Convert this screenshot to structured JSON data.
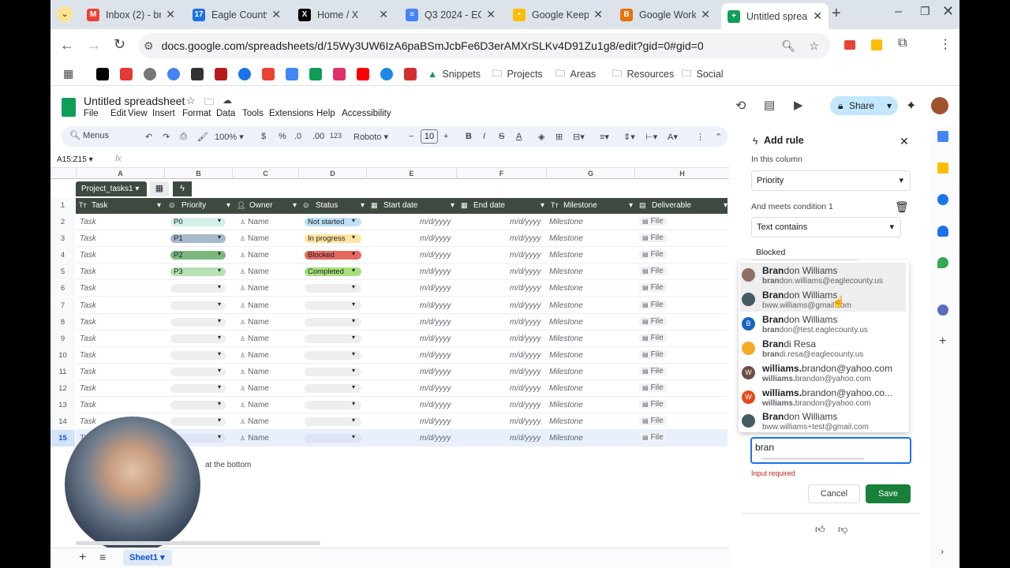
{
  "browser": {
    "tabs": [
      {
        "title": "Inbox (2) - bra",
        "color": "#ea4335",
        "glyph": "M"
      },
      {
        "title": "Eagle County",
        "color": "#1a73e8",
        "glyph": "17"
      },
      {
        "title": "Home / X",
        "color": "#000000",
        "glyph": "X"
      },
      {
        "title": "Q3 2024 - EC",
        "color": "#4285f4",
        "glyph": "≡"
      },
      {
        "title": "Google Keep",
        "color": "#fbbc04",
        "glyph": "•"
      },
      {
        "title": "Google Work",
        "color": "#e8710a",
        "glyph": "B"
      },
      {
        "title": "Untitled sprea",
        "color": "#0f9d58",
        "glyph": "+"
      }
    ],
    "url": "docs.google.com/spreadsheets/d/15Wy3UW6IzA6paBSmJcbFe6D3erAMXrSLKv4D91Zu1g8/edit?gid=0#gid=0",
    "bookmarks": [
      "Snippets",
      "Projects",
      "Areas",
      "Resources",
      "Social"
    ]
  },
  "sheets": {
    "title": "Untitled spreadsheet",
    "menus": [
      "File",
      "Edit",
      "View",
      "Insert",
      "Format",
      "Data",
      "Tools",
      "Extensions",
      "Help",
      "Accessibility"
    ],
    "share": "Share",
    "toolbar": {
      "search": "Menus",
      "zoom": "100%",
      "currency": "$",
      "percent": "%",
      "dec_down": ".0",
      "dec_up": ".00",
      "format": "123",
      "font": "Roboto",
      "size": "10"
    },
    "name_box": "A15:Z15",
    "fx": "fx",
    "columns": [
      "A",
      "B",
      "C",
      "D",
      "E",
      "F",
      "G",
      "H"
    ],
    "table_name": "Project_tasks1",
    "headers": [
      "Task",
      "Priority",
      "Owner",
      "Status",
      "Start date",
      "End date",
      "Milestone",
      "Deliverable"
    ],
    "rows": [
      {
        "n": "2",
        "task": "Task",
        "prio": "P0",
        "prio_color": "#d3f0e8",
        "owner": "Name",
        "status": "Not started",
        "status_color": "#bfe1f6",
        "start": "m/d/yyyy",
        "end": "m/d/yyyy",
        "ms": "Milestone",
        "file": "File"
      },
      {
        "n": "3",
        "task": "Task",
        "prio": "P1",
        "prio_color": "#a6b9c8",
        "owner": "Name",
        "status": "In progress",
        "status_color": "#ffe5a0",
        "start": "m/d/yyyy",
        "end": "m/d/yyyy",
        "ms": "Milestone",
        "file": "File"
      },
      {
        "n": "4",
        "task": "Task",
        "prio": "P2",
        "prio_color": "#7bb87e",
        "owner": "Name",
        "status": "Blocked",
        "status_color": "#e6695f",
        "start": "m/d/yyyy",
        "end": "m/d/yyyy",
        "ms": "Milestone",
        "file": "File"
      },
      {
        "n": "5",
        "task": "Task",
        "prio": "P3",
        "prio_color": "#b7e1b4",
        "owner": "Name",
        "status": "Completed",
        "status_color": "#a8e07d",
        "start": "m/d/yyyy",
        "end": "m/d/yyyy",
        "ms": "Milestone",
        "file": "File"
      },
      {
        "n": "6",
        "task": "Task",
        "prio": "",
        "prio_color": "#eeeeee",
        "owner": "Name",
        "status": "",
        "status_color": "#eeeeee",
        "start": "m/d/yyyy",
        "end": "m/d/yyyy",
        "ms": "Milestone",
        "file": "File"
      },
      {
        "n": "7",
        "task": "Task",
        "prio": "",
        "prio_color": "#eeeeee",
        "owner": "Name",
        "status": "",
        "status_color": "#eeeeee",
        "start": "m/d/yyyy",
        "end": "m/d/yyyy",
        "ms": "Milestone",
        "file": "File"
      },
      {
        "n": "8",
        "task": "Task",
        "prio": "",
        "prio_color": "#eeeeee",
        "owner": "Name",
        "status": "",
        "status_color": "#eeeeee",
        "start": "m/d/yyyy",
        "end": "m/d/yyyy",
        "ms": "Milestone",
        "file": "File"
      },
      {
        "n": "9",
        "task": "Task",
        "prio": "",
        "prio_color": "#eeeeee",
        "owner": "Name",
        "status": "",
        "status_color": "#eeeeee",
        "start": "m/d/yyyy",
        "end": "m/d/yyyy",
        "ms": "Milestone",
        "file": "File"
      },
      {
        "n": "10",
        "task": "Task",
        "prio": "",
        "prio_color": "#eeeeee",
        "owner": "Name",
        "status": "",
        "status_color": "#eeeeee",
        "start": "m/d/yyyy",
        "end": "m/d/yyyy",
        "ms": "Milestone",
        "file": "File"
      },
      {
        "n": "11",
        "task": "Task",
        "prio": "",
        "prio_color": "#eeeeee",
        "owner": "Name",
        "status": "",
        "status_color": "#eeeeee",
        "start": "m/d/yyyy",
        "end": "m/d/yyyy",
        "ms": "Milestone",
        "file": "File"
      },
      {
        "n": "12",
        "task": "Task",
        "prio": "",
        "prio_color": "#eeeeee",
        "owner": "Name",
        "status": "",
        "status_color": "#eeeeee",
        "start": "m/d/yyyy",
        "end": "m/d/yyyy",
        "ms": "Milestone",
        "file": "File"
      },
      {
        "n": "13",
        "task": "Task",
        "prio": "",
        "prio_color": "#eeeeee",
        "owner": "Name",
        "status": "",
        "status_color": "#eeeeee",
        "start": "m/d/yyyy",
        "end": "m/d/yyyy",
        "ms": "Milestone",
        "file": "File"
      },
      {
        "n": "14",
        "task": "Task",
        "prio": "",
        "prio_color": "#eeeeee",
        "owner": "Name",
        "status": "",
        "status_color": "#eeeeee",
        "start": "m/d/yyyy",
        "end": "m/d/yyyy",
        "ms": "Milestone",
        "file": "File"
      },
      {
        "n": "15",
        "task": "Task",
        "prio": "",
        "prio_color": "#dfe4f5",
        "owner": "Name",
        "status": "",
        "status_color": "#dfe4f5",
        "start": "m/d/yyyy",
        "end": "m/d/yyyy",
        "ms": "Milestone",
        "file": "File"
      }
    ],
    "note": "at the bottom",
    "sheet_tab": "Sheet1"
  },
  "panel": {
    "title": "Add rule",
    "in_column_label": "In this column",
    "column_value": "Priority",
    "condition_label": "And meets condition 1",
    "condition_value": "Text contains",
    "condition_text": "Blocked",
    "suggestions": [
      {
        "bold": "Bran",
        "rest": "don Williams",
        "ebold": "bran",
        "erest": "don.williams@eaglecounty.us",
        "av": "#8d6e63",
        "ini": ""
      },
      {
        "bold": "Bran",
        "rest": "don Williams",
        "ebold": "",
        "erest": "bww.williams@gmail.com",
        "av": "#455a64",
        "ini": ""
      },
      {
        "bold": "Bran",
        "rest": "don Williams",
        "ebold": "bran",
        "erest": "don@test.eaglecounty.us",
        "av": "#1565c0",
        "ini": "B"
      },
      {
        "bold": "Bran",
        "rest": "di Resa",
        "ebold": "bran",
        "erest": "di.resa@eaglecounty.us",
        "av": "#f9a825",
        "ini": ""
      },
      {
        "bold": "williams.",
        "rest": "brandon@yahoo.com",
        "ebold": "williams.",
        "erest": "brandon@yahoo.com",
        "av": "#6d4c41",
        "ini": "W"
      },
      {
        "bold": "williams.",
        "rest": "brandon@yahoo.co...",
        "ebold": "williams.",
        "erest": "brandon@yahoo.com",
        "av": "#e64a19",
        "ini": "W"
      },
      {
        "bold": "Bran",
        "rest": "don Williams",
        "ebold": "",
        "erest": "bww.williams+test@gmail.com",
        "av": "#455a64",
        "ini": ""
      }
    ],
    "input_value": "bran",
    "error": "Input required",
    "cancel": "Cancel",
    "save": "Save"
  },
  "colors": {
    "accent": "#188038",
    "brand_blue": "#1a73e8",
    "header_green": "#3e4a3f"
  }
}
